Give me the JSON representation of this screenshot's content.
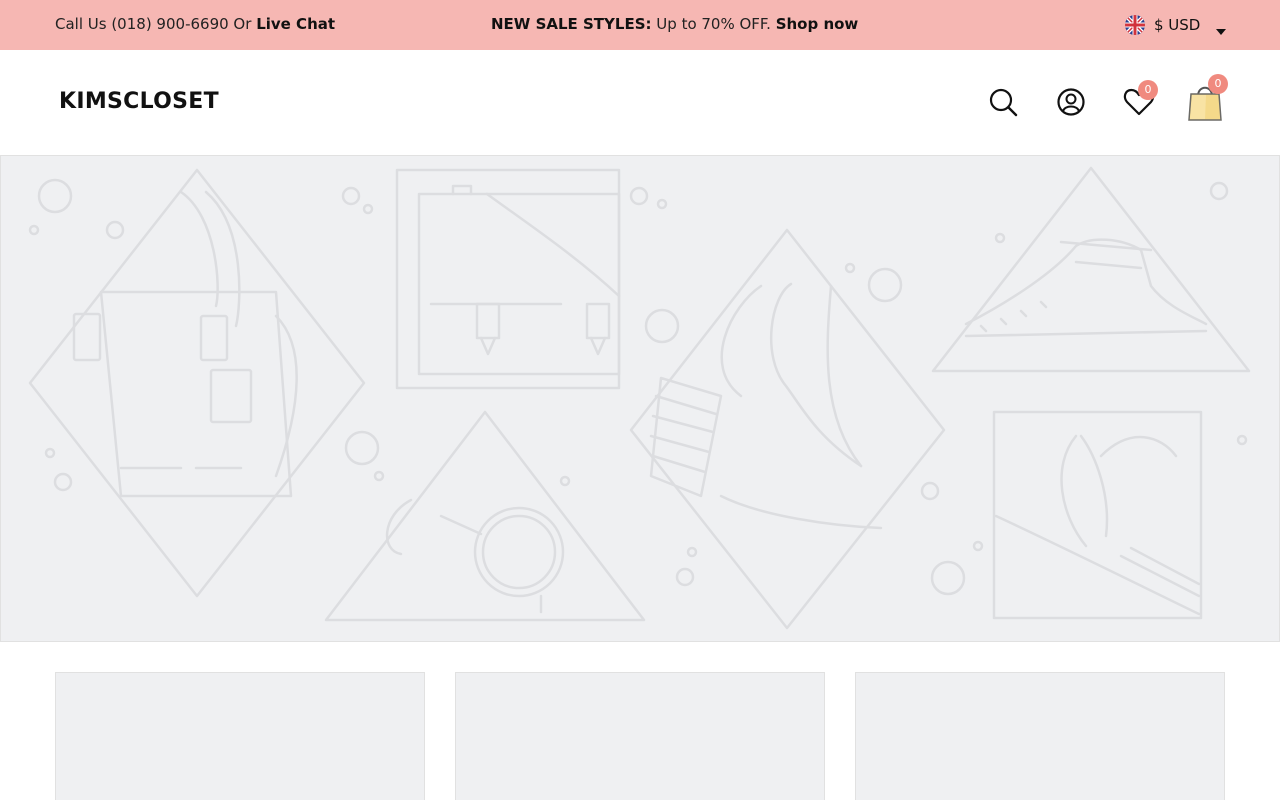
{
  "announcement": {
    "call_text": "Call Us (018) 900-6690 Or",
    "live_chat_label": "Live Chat",
    "promo_bold": "NEW SALE STYLES:",
    "promo_text": "Up to 70% OFF.",
    "shop_now_label": "Shop now",
    "currency_label": "$ USD",
    "currency_flag_icon": "uk-flag-icon"
  },
  "header": {
    "logo_text": "KIMSCLOSET",
    "search_icon": "search-icon",
    "account_icon": "account-icon",
    "wishlist_icon": "heart-icon",
    "wishlist_count": "0",
    "cart_icon": "shopping-bag-icon",
    "cart_count": "0"
  },
  "colors": {
    "announcement_bg": "#f6b7b3",
    "badge": "#f08a7f",
    "placeholder_bg": "#eff0f2",
    "placeholder_line": "#dcdde0"
  }
}
